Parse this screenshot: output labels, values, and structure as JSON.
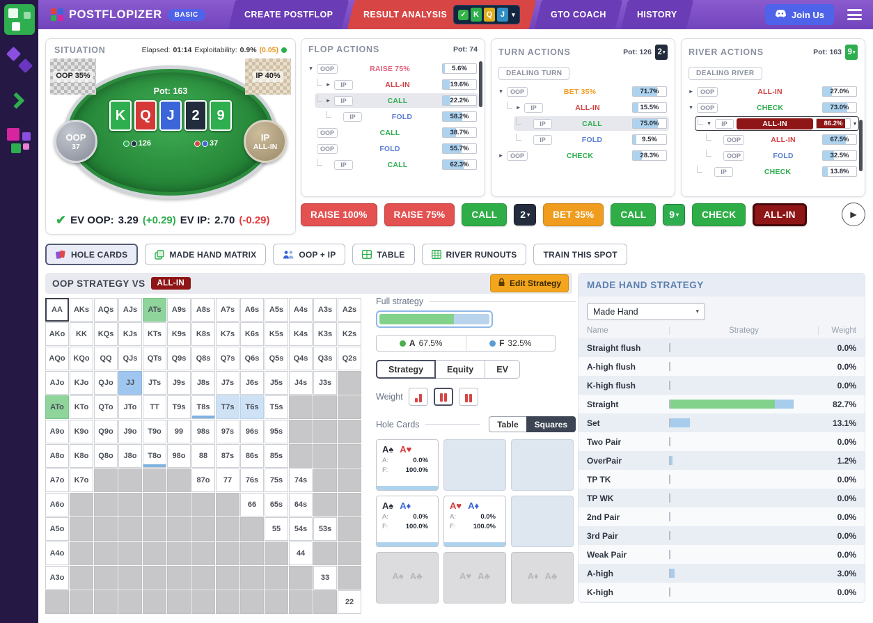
{
  "glyphs": {
    "caret": "▾",
    "check": "✓",
    "ev_check": "✔",
    "play": "▶"
  },
  "nav": {
    "logo": "POSTFLOPIZER",
    "badge": "BASIC",
    "join": "Join Us",
    "tabs": [
      {
        "label": "CREATE POSTFLOP"
      },
      {
        "label": "RESULT ANALYSIS",
        "active": true,
        "has_selector": true
      },
      {
        "label": "GTO COACH"
      },
      {
        "label": "HISTORY"
      }
    ],
    "selector_cards": [
      {
        "rank": "K",
        "color": "#2eae4e"
      },
      {
        "rank": "Q",
        "color": "#dfae1c"
      },
      {
        "rank": "J",
        "color": "#2f8fc4"
      }
    ]
  },
  "situation": {
    "title": "SITUATION",
    "stats": {
      "elapsed_label": "Elapsed:",
      "elapsed": "01:14",
      "expl_label": "Exploitability:",
      "expl": "0.9%",
      "expl_paren": "(0.05)"
    },
    "pot": "Pot: 163",
    "board": [
      {
        "rank": "K",
        "color": "#2eae4e"
      },
      {
        "rank": "Q",
        "color": "#d63838"
      },
      {
        "rank": "J",
        "color": "#3a66d9"
      },
      {
        "rank": "2",
        "color": "#232c3d"
      },
      {
        "rank": "9",
        "color": "#2eae4e"
      }
    ],
    "corner_left": "OOP 35%",
    "corner_right": "IP 40%",
    "oop": {
      "name": "OOP",
      "stack": "37"
    },
    "ip": {
      "name": "IP",
      "stack": "ALL-IN"
    },
    "bets": {
      "oop": "126",
      "ip": "37"
    },
    "ev": {
      "oop_label": "EV OOP:",
      "oop": "3.29",
      "oop_delta": "(+0.29)",
      "ip_label": "EV IP:",
      "ip": "2.70",
      "ip_delta": "(-0.29)"
    }
  },
  "panels": [
    {
      "title": "FLOP ACTIONS",
      "pot": "Pot: 74",
      "rows": [
        {
          "indent": 0,
          "chev": "▾",
          "player": "OOP",
          "action": "RAISE 75%",
          "ac": "raise",
          "pct": "5.6%",
          "fill": 6
        },
        {
          "indent": 1,
          "chev": "▸",
          "player": "IP",
          "action": "ALL-IN",
          "ac": "allin",
          "pct": "19.6%",
          "fill": 20
        },
        {
          "indent": 1,
          "chev": "▸",
          "player": "IP",
          "action": "CALL",
          "ac": "call",
          "pct": "22.2%",
          "fill": 22,
          "sel": "gray"
        },
        {
          "indent": 2,
          "player": "IP",
          "action": "FOLD",
          "ac": "fold",
          "pct": "58.2%",
          "fill": 58
        },
        {
          "indent": 0,
          "player": "OOP",
          "action": "CALL",
          "ac": "call",
          "pct": "38.7%",
          "fill": 39
        },
        {
          "indent": 0,
          "player": "OOP",
          "action": "FOLD",
          "ac": "fold",
          "pct": "55.7%",
          "fill": 56
        },
        {
          "indent": 1,
          "player": "IP",
          "action": "CALL",
          "ac": "call",
          "pct": "62.3%",
          "fill": 62
        }
      ]
    },
    {
      "title": "TURN ACTIONS",
      "pot": "Pot: 126",
      "card": {
        "rank": "2",
        "color": "#232c3d"
      },
      "dealing": "DEALING TURN",
      "rows": [
        {
          "indent": 0,
          "chev": "▾",
          "player": "OOP",
          "action": "BET 35%",
          "ac": "bet",
          "pct": "71.7%",
          "fill": 72
        },
        {
          "indent": 1,
          "chev": "▸",
          "player": "IP",
          "action": "ALL-IN",
          "ac": "allin",
          "pct": "15.5%",
          "fill": 16
        },
        {
          "indent": 2,
          "player": "IP",
          "action": "CALL",
          "ac": "call",
          "pct": "75.0%",
          "fill": 75,
          "sel": "gray"
        },
        {
          "indent": 2,
          "player": "IP",
          "action": "FOLD",
          "ac": "fold",
          "pct": "9.5%",
          "fill": 10
        },
        {
          "indent": 0,
          "chev": "▸",
          "player": "OOP",
          "action": "CHECK",
          "ac": "check",
          "pct": "28.3%",
          "fill": 28
        }
      ]
    },
    {
      "title": "RIVER ACTIONS",
      "pot": "Pot: 163",
      "card": {
        "rank": "9",
        "color": "#2eae4e"
      },
      "dealing": "DEALING RIVER",
      "rows": [
        {
          "indent": 0,
          "chev": "▸",
          "player": "OOP",
          "action": "ALL-IN",
          "ac": "allin",
          "pct": "27.0%",
          "fill": 27
        },
        {
          "indent": 0,
          "chev": "▾",
          "player": "OOP",
          "action": "CHECK",
          "ac": "check",
          "pct": "73.0%",
          "fill": 73
        },
        {
          "indent": 1,
          "chev": "▾",
          "player": "IP",
          "action": "ALL-IN",
          "ac": "allin",
          "pct": "86.2%",
          "fill": 86,
          "sel": "dark",
          "fillStyle": "dark",
          "pill": true,
          "caret_after": true
        },
        {
          "indent": 2,
          "player": "OOP",
          "action": "ALL-IN",
          "ac": "allin",
          "pct": "67.5%",
          "fill": 68
        },
        {
          "indent": 2,
          "player": "OOP",
          "action": "FOLD",
          "ac": "fold",
          "pct": "32.5%",
          "fill": 33
        },
        {
          "indent": 1,
          "player": "IP",
          "action": "CHECK",
          "ac": "check",
          "pct": "13.8%",
          "fill": 14
        }
      ]
    }
  ],
  "action_bar": [
    {
      "type": "btn",
      "label": "RAISE 100%",
      "style": "raise"
    },
    {
      "type": "btn",
      "label": "RAISE 75%",
      "style": "raise"
    },
    {
      "type": "btn",
      "label": "CALL",
      "style": "call"
    },
    {
      "type": "card",
      "rank": "2",
      "color": "#232c3d"
    },
    {
      "type": "btn",
      "label": "BET 35%",
      "style": "bet"
    },
    {
      "type": "btn",
      "label": "CALL",
      "style": "call"
    },
    {
      "type": "card",
      "rank": "9",
      "color": "#2eae4e"
    },
    {
      "type": "btn",
      "label": "CHECK",
      "style": "call"
    },
    {
      "type": "btn",
      "label": "ALL-IN",
      "style": "allin",
      "selected": true
    },
    {
      "type": "play"
    }
  ],
  "view_tabs": [
    {
      "label": "HOLE CARDS",
      "icon": "hole-cards",
      "active": true
    },
    {
      "label": "MADE HAND MATRIX",
      "icon": "made-hand-matrix"
    },
    {
      "label": "OOP + IP",
      "icon": "oop-ip"
    },
    {
      "label": "TABLE",
      "icon": "table"
    },
    {
      "label": "RIVER RUNOUTS",
      "icon": "river-runouts"
    },
    {
      "label": "TRAIN THIS SPOT"
    }
  ],
  "strategy_header": {
    "title": "OOP STRATEGY VS",
    "vs_badge": "ALL-IN",
    "edit_btn": "Edit Strategy"
  },
  "matrix": {
    "rows": [
      [
        "AA|sel",
        "AKs",
        "AQs",
        "AJs",
        "ATs|green",
        "A9s",
        "A8s",
        "A7s",
        "A6s",
        "A5s",
        "A4s",
        "A3s",
        "A2s"
      ],
      [
        "AKo",
        "KK",
        "KQs",
        "KJs",
        "KTs",
        "K9s",
        "K8s",
        "K7s",
        "K6s",
        "K5s",
        "K4s",
        "K3s",
        "K2s"
      ],
      [
        "AQo",
        "KQo",
        "QQ",
        "QJs",
        "QTs",
        "Q9s",
        "Q8s",
        "Q7s",
        "Q6s",
        "Q5s",
        "Q4s",
        "Q3s",
        "Q2s"
      ],
      [
        "AJo",
        "KJo",
        "QJo",
        "JJ|blue",
        "JTs",
        "J9s",
        "J8s",
        "J7s",
        "J6s",
        "J5s",
        "J4s",
        "J3s",
        ""
      ],
      [
        "ATo|green",
        "KTo",
        "QTo",
        "JTo",
        "TT",
        "T9s",
        "T8s|ublue",
        "T7s|lblue",
        "T6s|lblue",
        "T5s",
        "",
        "",
        ""
      ],
      [
        "A9o",
        "K9o",
        "Q9o",
        "J9o",
        "T9o",
        "99",
        "98s",
        "97s",
        "96s",
        "95s",
        "",
        "",
        ""
      ],
      [
        "A8o",
        "K8o",
        "Q8o",
        "J8o",
        "T8o|ublue",
        "98o",
        "88",
        "87s",
        "86s",
        "85s",
        "",
        "",
        ""
      ],
      [
        "A7o",
        "K7o",
        "",
        "",
        "",
        "",
        "87o",
        "77",
        "76s",
        "75s",
        "74s",
        "",
        ""
      ],
      [
        "A6o",
        "",
        "",
        "",
        "",
        "",
        "",
        "",
        "66",
        "65s",
        "64s",
        "",
        ""
      ],
      [
        "A5o",
        "",
        "",
        "",
        "",
        "",
        "",
        "",
        "",
        "55",
        "54s",
        "53s",
        ""
      ],
      [
        "A4o",
        "",
        "",
        "",
        "",
        "",
        "",
        "",
        "",
        "",
        "44",
        "",
        ""
      ],
      [
        "A3o",
        "",
        "",
        "",
        "",
        "",
        "",
        "",
        "",
        "",
        "",
        "33",
        ""
      ],
      [
        "",
        "",
        "",
        "",
        "",
        "",
        "",
        "",
        "",
        "",
        "",
        "",
        "22"
      ]
    ]
  },
  "strategy_panel": {
    "full_label": "Full strategy",
    "bar": {
      "green": 67.5,
      "blue": 32.5
    },
    "legend": [
      {
        "color": "#4cae4c",
        "label": "A",
        "value": "67.5%"
      },
      {
        "color": "#5b9bd5",
        "label": "F",
        "value": "32.5%"
      }
    ],
    "tabs": [
      {
        "label": "Strategy",
        "active": true
      },
      {
        "label": "Equity"
      },
      {
        "label": "EV"
      }
    ],
    "weight_label": "Weight",
    "hole_cards_label": "Hole Cards",
    "toggle": [
      {
        "label": "Table"
      },
      {
        "label": "Squares",
        "active": true
      }
    ],
    "a_label": "A:",
    "f_label": "F:"
  },
  "combos": [
    [
      {
        "t": "filled",
        "cards": [
          {
            "r": "A",
            "suit": "spade"
          },
          {
            "r": "A",
            "suit": "heart"
          }
        ],
        "a": "0.0%",
        "f": "100.0%"
      },
      {
        "t": "empty"
      },
      {
        "t": "empty"
      }
    ],
    [
      {
        "t": "filled",
        "cards": [
          {
            "r": "A",
            "suit": "spade"
          },
          {
            "r": "A",
            "suit": "diamond"
          }
        ],
        "a": "0.0%",
        "f": "100.0%"
      },
      {
        "t": "filled",
        "cards": [
          {
            "r": "A",
            "suit": "heart"
          },
          {
            "r": "A",
            "suit": "diamond"
          }
        ],
        "a": "0.0%",
        "f": "100.0%"
      },
      {
        "t": "empty"
      }
    ],
    [
      {
        "t": "dead",
        "cards": [
          {
            "r": "A",
            "suit": "spade"
          },
          {
            "r": "A",
            "suit": "club"
          }
        ]
      },
      {
        "t": "dead",
        "cards": [
          {
            "r": "A",
            "suit": "heart"
          },
          {
            "r": "A",
            "suit": "club"
          }
        ]
      },
      {
        "t": "dead",
        "cards": [
          {
            "r": "A",
            "suit": "diamond"
          },
          {
            "r": "A",
            "suit": "club"
          }
        ]
      }
    ]
  ],
  "made_hand": {
    "title": "MADE HAND STRATEGY",
    "dropdown": "Made Hand",
    "headers": [
      "Name",
      "Strategy",
      "Weight"
    ],
    "rows": [
      {
        "name": "Straight flush",
        "green": 0,
        "blue": 0,
        "weight": "0.0%"
      },
      {
        "name": "A-high flush",
        "green": 0,
        "blue": 0,
        "weight": "0.0%"
      },
      {
        "name": "K-high flush",
        "green": 0,
        "blue": 0,
        "weight": "0.0%"
      },
      {
        "name": "Straight",
        "green": 70,
        "blue": 12.7,
        "weight": "82.7%"
      },
      {
        "name": "Set",
        "green": 0,
        "blue": 13.1,
        "weight": "13.1%"
      },
      {
        "name": "Two Pair",
        "green": 0,
        "blue": 0,
        "weight": "0.0%"
      },
      {
        "name": "OverPair",
        "green": 0,
        "blue": 1.2,
        "weight": "1.2%"
      },
      {
        "name": "TP TK",
        "green": 0,
        "blue": 0,
        "weight": "0.0%"
      },
      {
        "name": "TP WK",
        "green": 0,
        "blue": 0,
        "weight": "0.0%"
      },
      {
        "name": "2nd Pair",
        "green": 0,
        "blue": 0,
        "weight": "0.0%"
      },
      {
        "name": "3rd Pair",
        "green": 0,
        "blue": 0,
        "weight": "0.0%"
      },
      {
        "name": "Weak Pair",
        "green": 0,
        "blue": 0,
        "weight": "0.0%"
      },
      {
        "name": "A-high",
        "green": 0,
        "blue": 3.0,
        "weight": "3.0%"
      },
      {
        "name": "K-high",
        "green": 0,
        "blue": 0,
        "weight": "0.0%"
      }
    ]
  }
}
